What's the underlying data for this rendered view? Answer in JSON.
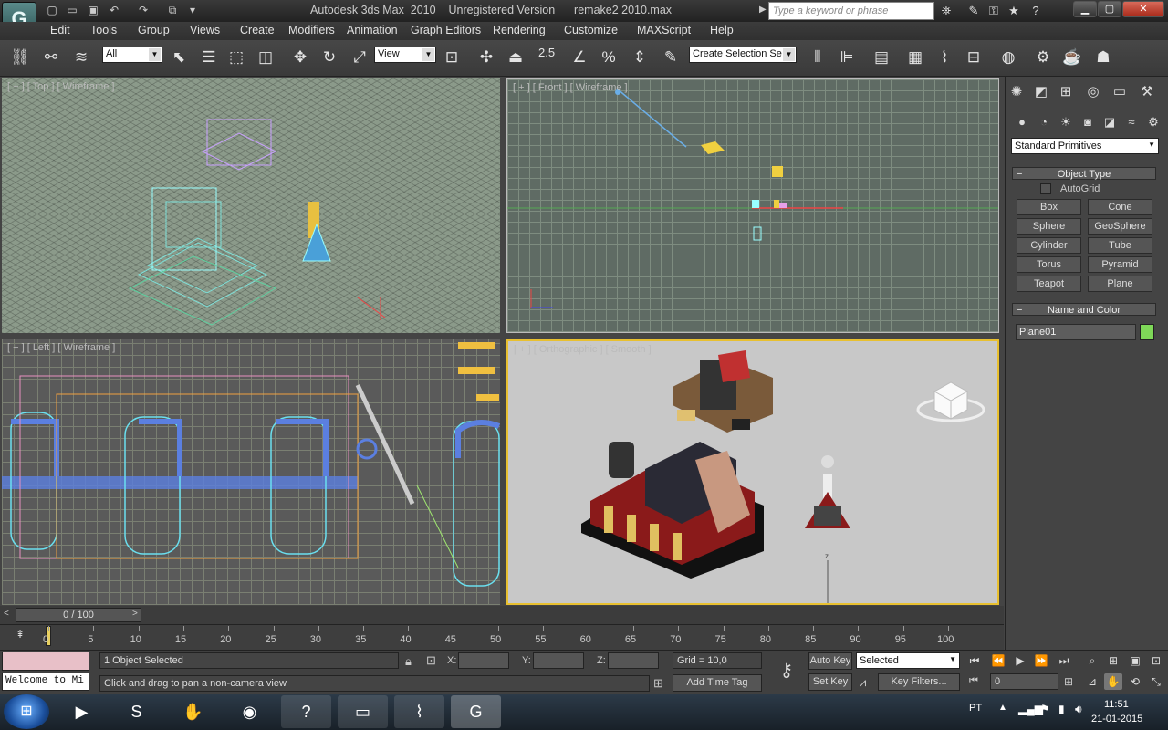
{
  "window": {
    "title": "Autodesk 3ds Max  2010    Unregistered Version      remake2 2010.max",
    "search_placeholder": "Type a keyword or phrase",
    "app_letter": "G"
  },
  "menu": [
    "Edit",
    "Tools",
    "Group",
    "Views",
    "Create",
    "Modifiers",
    "Animation",
    "Graph Editors",
    "Rendering",
    "Customize",
    "MAXScript",
    "Help"
  ],
  "toolbar": {
    "selection_filter": "All",
    "ref_coord": "View",
    "snap_label": "2.5",
    "named_selection": "Create Selection Se"
  },
  "viewports": {
    "top": "[ + ] [ Top ] [ Wireframe ]",
    "front": "[ + ] [ Front ] [ Wireframe ]",
    "left": "[ + ] [ Left ] [ Wireframe ]",
    "persp": "[ + ] [ Orthographic ] [ Smooth ]"
  },
  "command_panel": {
    "category": "Standard Primitives",
    "object_type_title": "Object Type",
    "autogrid_label": "AutoGrid",
    "buttons": [
      "Box",
      "Cone",
      "Sphere",
      "GeoSphere",
      "Cylinder",
      "Tube",
      "Torus",
      "Pyramid",
      "Teapot",
      "Plane"
    ],
    "name_color_title": "Name and Color",
    "object_name": "Plane01",
    "object_color": "#7ed858"
  },
  "timeline": {
    "frame_display": "0 / 100",
    "ticks": [
      "0",
      "5",
      "10",
      "15",
      "20",
      "25",
      "30",
      "35",
      "40",
      "45",
      "50",
      "55",
      "60",
      "65",
      "70",
      "75",
      "80",
      "85",
      "90",
      "95",
      "100"
    ]
  },
  "status": {
    "selection": "1 Object Selected",
    "prompt": "Click and drag to pan a non-camera view",
    "listener": "Welcome to Mi",
    "x_label": "X:",
    "y_label": "Y:",
    "z_label": "Z:",
    "grid": "Grid = 10,0",
    "add_time_tag": "Add Time Tag",
    "auto_key": "Auto Key",
    "set_key": "Set Key",
    "key_mode": "Selected",
    "key_filters": "Key Filters...",
    "current_frame": "0"
  },
  "taskbar": {
    "language": "PT",
    "time": "11:51",
    "date": "21-01-2015"
  }
}
